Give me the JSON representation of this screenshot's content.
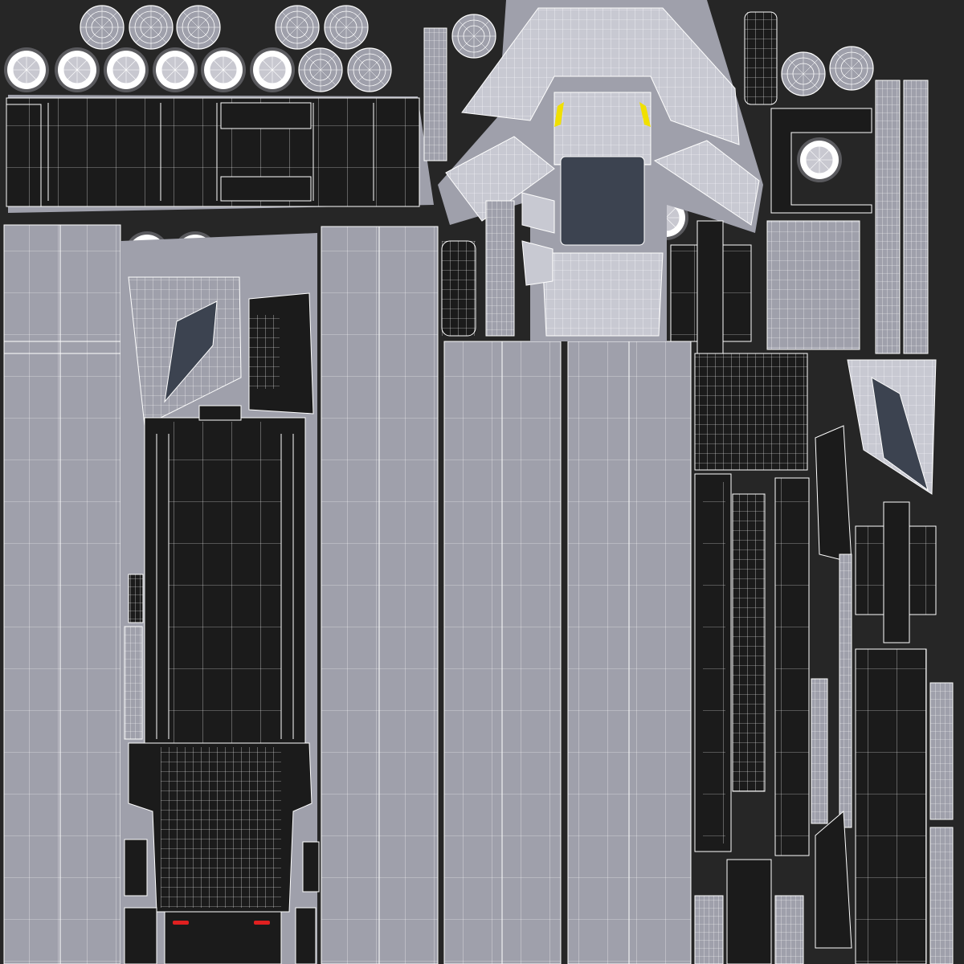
{
  "colors": {
    "background": "#262626",
    "island_light": "#9fa0ab",
    "island_dark": "#1b1b1b",
    "wire": "#ffffff",
    "accent_yellow": "#f0e000",
    "accent_red": "#e02020",
    "glass": "#3c4350"
  },
  "islands": [
    "wheel-islands",
    "side-panel-strips",
    "cab-roof-shell",
    "chassis-frame",
    "trailer-side-walls",
    "small-parts-cluster"
  ]
}
